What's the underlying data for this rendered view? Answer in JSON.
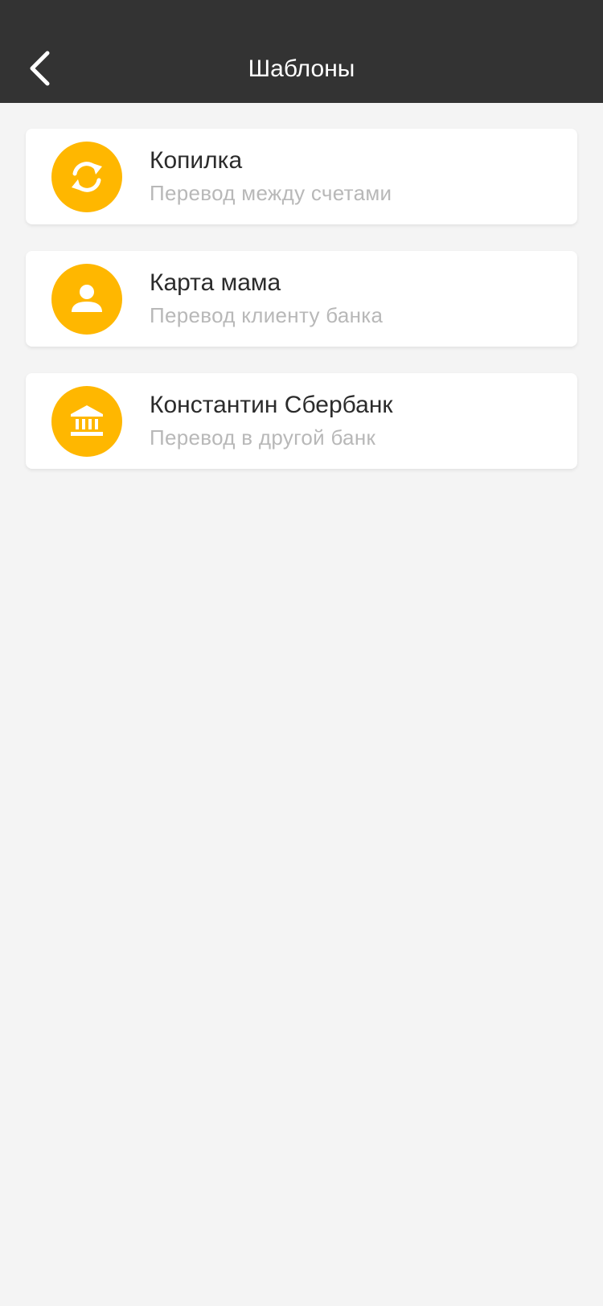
{
  "header": {
    "title": "Шаблоны",
    "back_icon": "chevron-left-icon",
    "background": "#333333"
  },
  "templates": [
    {
      "title": "Копилка",
      "subtitle": "Перевод между счетами",
      "icon": "refresh-arrows-icon"
    },
    {
      "title": "Карта мама",
      "subtitle": "Перевод клиенту банка",
      "icon": "person-icon"
    },
    {
      "title": "Константин Сбербанк",
      "subtitle": "Перевод в другой банк",
      "icon": "bank-icon"
    }
  ],
  "colors": {
    "accent": "#ffb700",
    "page_background": "#f4f4f4",
    "title_text": "#2b2b2b",
    "subtitle_text": "#b8b8b8"
  }
}
